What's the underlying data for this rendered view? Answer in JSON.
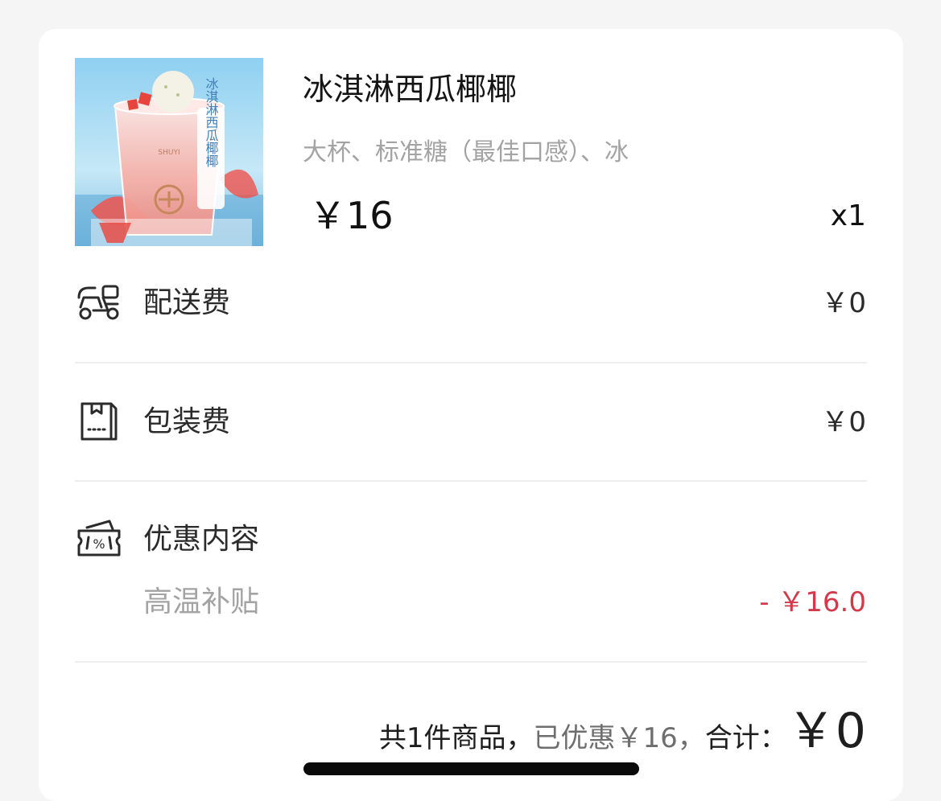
{
  "product": {
    "name": "冰淇淋西瓜椰椰",
    "spec": "大杯、标准糖（最佳口感）、冰",
    "price": "￥16",
    "qty": "x1",
    "image_alt": "ice-cream-watermelon-coconut-drink",
    "image_text": "冰淇淋西瓜椰椰"
  },
  "fees": {
    "delivery": {
      "label": "配送费",
      "value": "￥0",
      "icon": "scooter-icon"
    },
    "packaging": {
      "label": "包装费",
      "value": "￥0",
      "icon": "package-bag-icon"
    }
  },
  "discount": {
    "label": "优惠内容",
    "icon": "coupon-icon",
    "item_label": "高温补贴",
    "item_value": "- ￥16.0"
  },
  "summary": {
    "count": "共1件商品，",
    "discount": "已优惠￥16，",
    "total_label": "合计：",
    "total": "￥0"
  },
  "colors": {
    "discount_red": "#d23a4a",
    "card_bg": "#ffffff",
    "page_bg": "#f5f5f5"
  }
}
